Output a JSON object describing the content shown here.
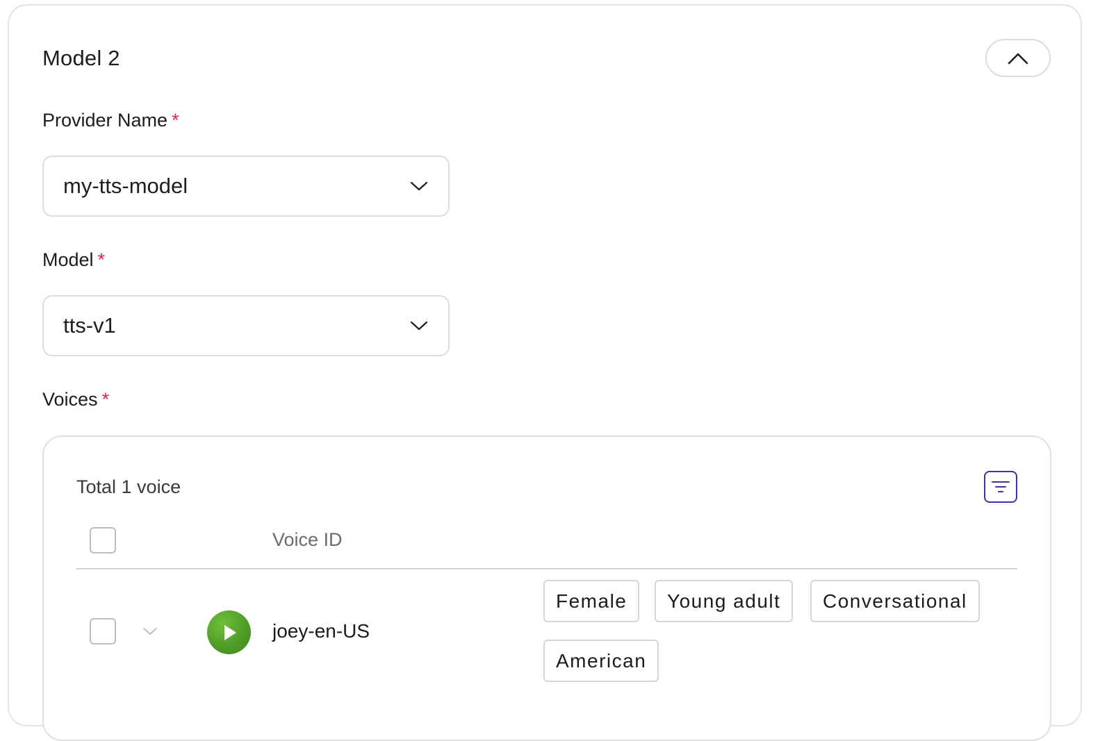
{
  "card": {
    "title": "Model 2"
  },
  "fields": {
    "provider": {
      "label": "Provider Name",
      "required_mark": "*",
      "value": "my-tts-model"
    },
    "model": {
      "label": "Model",
      "required_mark": "*",
      "value": "tts-v1"
    },
    "voices": {
      "label": "Voices",
      "required_mark": "*"
    }
  },
  "voices_panel": {
    "total_text": "Total 1 voice",
    "columns": {
      "voice_id": "Voice ID"
    },
    "rows": [
      {
        "voice_id": "joey-en-US",
        "tags": [
          "Female",
          "Young adult",
          "Conversational",
          "American"
        ]
      }
    ]
  },
  "colors": {
    "required": "#e0245e",
    "filter_accent": "#3d2fa8",
    "play_green": "#4d9a26"
  }
}
